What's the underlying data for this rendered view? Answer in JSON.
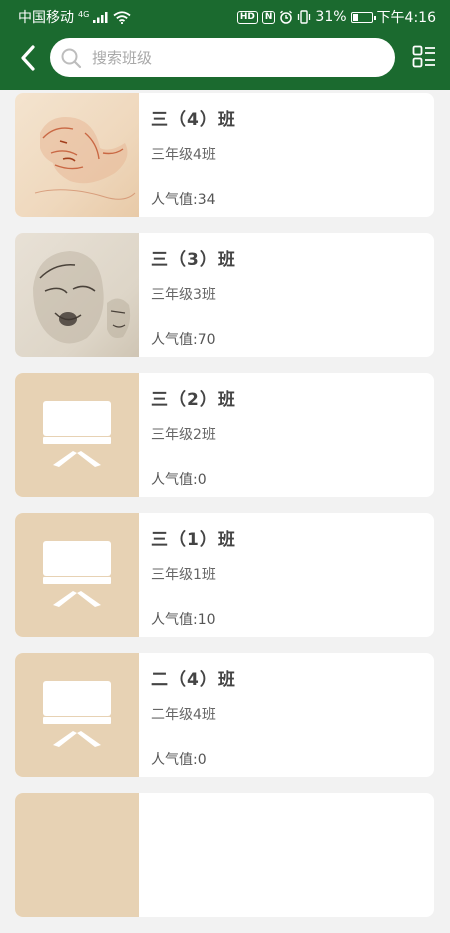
{
  "status_bar": {
    "carrier": "中国移动",
    "network": "4G",
    "battery": "31%",
    "battery_level": 0.31,
    "time": "下午4:16"
  },
  "header": {
    "back_icon": "back-arrow-icon",
    "search_placeholder": "搜索班级",
    "menu_icon": "list-view-icon"
  },
  "colors": {
    "header_bg": "#1b6a2f",
    "thumb_placeholder_bg": "#e7d2b4"
  },
  "classes": [
    {
      "name": "三（4）班",
      "grade": "三年级4班",
      "popularity": "人气值:34",
      "thumb": "sketch-red-chalk"
    },
    {
      "name": "三（3）班",
      "grade": "三年级3班",
      "popularity": "人气值:70",
      "thumb": "sketch-heads"
    },
    {
      "name": "三（2）班",
      "grade": "三年级2班",
      "popularity": "人气值:0",
      "thumb": "blackboard-icon"
    },
    {
      "name": "三（1）班",
      "grade": "三年级1班",
      "popularity": "人气值:10",
      "thumb": "blackboard-icon"
    },
    {
      "name": "二（4）班",
      "grade": "二年级4班",
      "popularity": "人气值:0",
      "thumb": "blackboard-icon"
    }
  ]
}
